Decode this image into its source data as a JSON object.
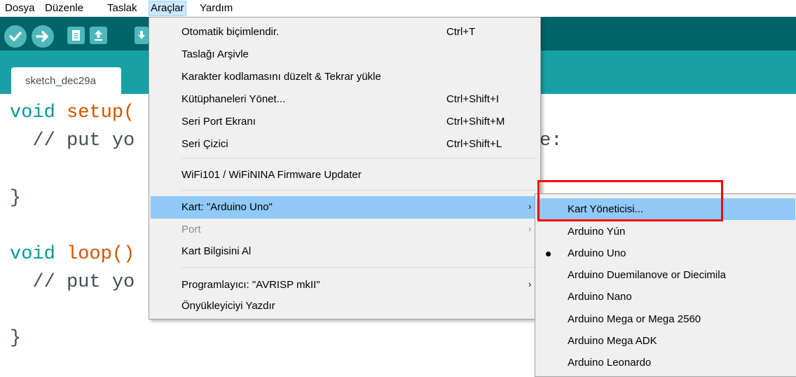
{
  "menubar": [
    "Dosya",
    "Düzenle",
    "Taslak",
    "Araçlar",
    "Yardım"
  ],
  "tab": {
    "label": "sketch_dec29a"
  },
  "code": {
    "line1_kw": "void",
    "line1_rest": " setup(",
    "line2": "  // put yo",
    "line2_tail": "e:",
    "line3": "}",
    "line4_kw": "void",
    "line4_rest": " loop()",
    "line5": "  // put yo",
    "line6": "}"
  },
  "tools_menu": {
    "items": [
      {
        "label": "Otomatik biçimlendir.",
        "shortcut": "Ctrl+T"
      },
      {
        "label": "Taslağı Arşivle",
        "shortcut": ""
      },
      {
        "label": "Karakter kodlamasını düzelt & Tekrar yükle",
        "shortcut": ""
      },
      {
        "label": "Kütüphaneleri Yönet...",
        "shortcut": "Ctrl+Shift+I"
      },
      {
        "label": "Seri Port Ekranı",
        "shortcut": "Ctrl+Shift+M"
      },
      {
        "label": "Seri Çizici",
        "shortcut": "Ctrl+Shift+L"
      },
      {
        "label": "WiFi101 / WiFiNINA Firmware Updater",
        "shortcut": ""
      },
      {
        "label": "Kart: \"Arduino Uno\"",
        "arrow": "›"
      },
      {
        "label": "Port",
        "arrow": "›"
      },
      {
        "label": "Kart Bilgisini Al"
      },
      {
        "label": "Programlayıcı: \"AVRISP mkII\"",
        "arrow": "›"
      },
      {
        "label": "Önyükleyiciyi Yazdır"
      }
    ]
  },
  "board_menu": {
    "items": [
      "Kart Yöneticisi...",
      "Arduino Yún",
      "Arduino Uno",
      "Arduino Duemilanove or Diecimila",
      "Arduino Nano",
      "Arduino Mega or Mega 2560",
      "Arduino Mega ADK",
      "Arduino Leonardo"
    ],
    "selected": "Arduino Uno"
  },
  "colors": {
    "toolbar": "#006468",
    "tabstrip": "#17a1a5",
    "button": "#4db7bb",
    "highlight": "#91c9f7",
    "callout": "#ff0000"
  },
  "icons": [
    "verify-icon",
    "upload-icon",
    "new-icon",
    "open-icon",
    "save-icon"
  ]
}
